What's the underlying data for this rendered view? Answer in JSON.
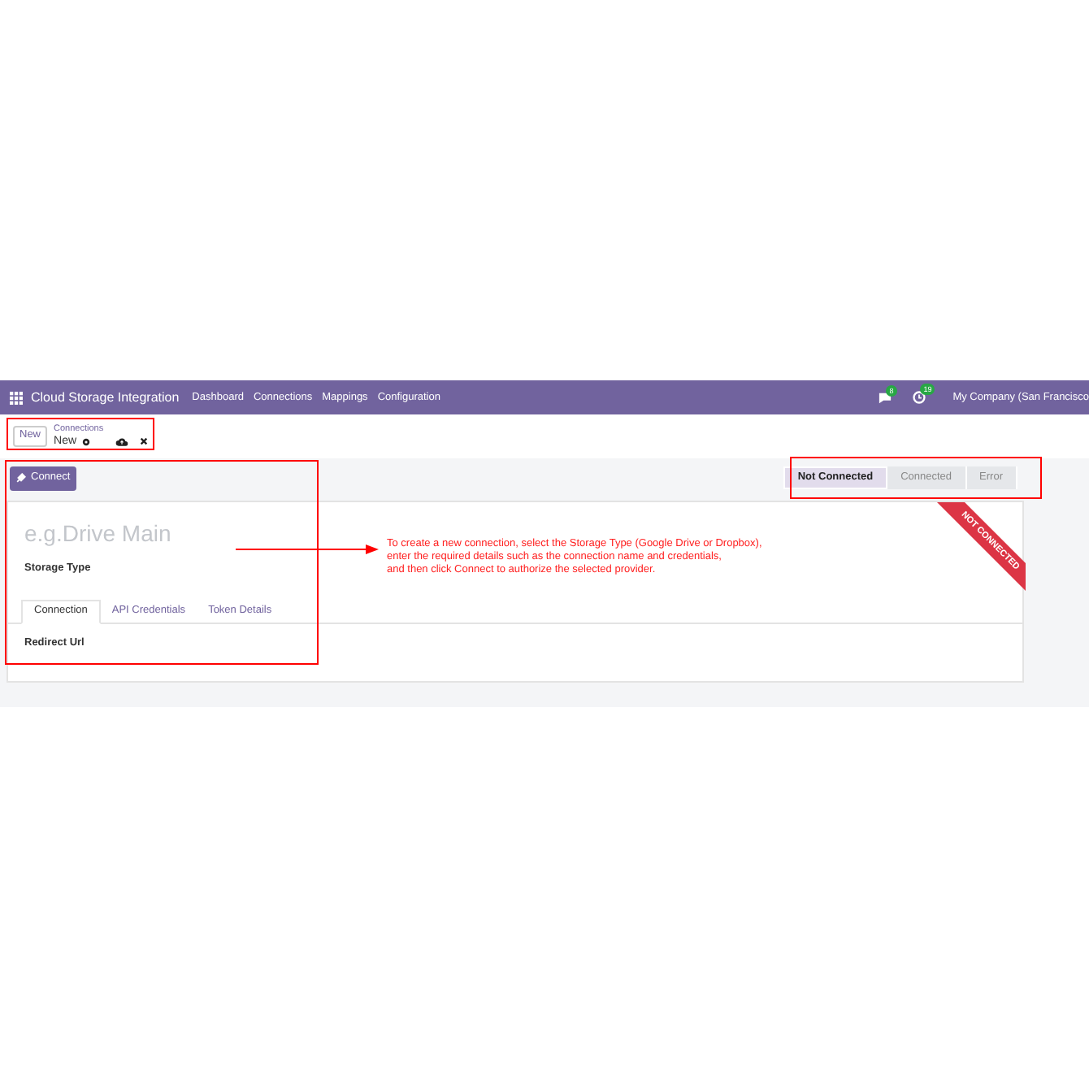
{
  "navbar": {
    "app_title": "Cloud Storage Integration",
    "menu": [
      "Dashboard",
      "Connections",
      "Mappings",
      "Configuration"
    ],
    "messages_count": "8",
    "activities_count": "19",
    "company": "My Company (San Francisco"
  },
  "control_panel": {
    "new_button": "New",
    "breadcrumb": "Connections",
    "record": "New"
  },
  "connect_button": "Connect",
  "statusbar": [
    {
      "label": "Not Connected",
      "selected": true
    },
    {
      "label": "Connected",
      "selected": false
    },
    {
      "label": "Error",
      "selected": false
    }
  ],
  "ribbon": "NOT CONNECTED",
  "form": {
    "name_placeholder": "e.g.Drive Main",
    "fields": [
      {
        "label": "Storage Type"
      }
    ],
    "tabs": [
      {
        "label": "Connection",
        "selected": true
      },
      {
        "label": "API Credentials",
        "selected": false
      },
      {
        "label": "Token Details",
        "selected": false
      }
    ],
    "tab_fields": [
      {
        "label": "Redirect Url"
      }
    ]
  },
  "annotation": [
    "To create a new connection, select the Storage Type (Google Drive or Dropbox),",
    "enter the required details such as the connection name and credentials,",
    "and then click Connect to authorize the selected provider."
  ]
}
